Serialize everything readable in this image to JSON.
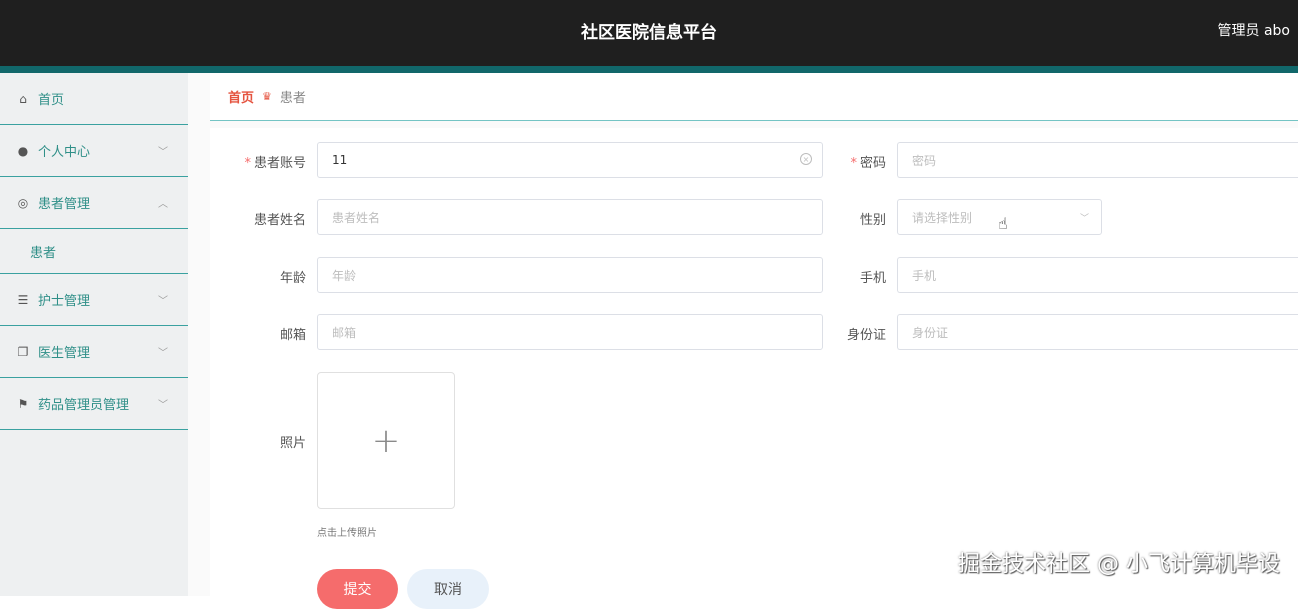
{
  "header": {
    "title": "社区医院信息平台",
    "user": "管理员 abo"
  },
  "sidebar": {
    "items": [
      {
        "label": "首页",
        "icon": "home-icon"
      },
      {
        "label": "个人中心",
        "icon": "user-icon"
      },
      {
        "label": "患者管理",
        "icon": "lifebuoy-icon"
      },
      {
        "label": "护士管理",
        "icon": "list-icon"
      },
      {
        "label": "医生管理",
        "icon": "copy-icon"
      },
      {
        "label": "药品管理员管理",
        "icon": "flag-icon"
      }
    ],
    "submenu": {
      "label": "患者"
    }
  },
  "breadcrumb": {
    "home": "首页",
    "current": "患者"
  },
  "form": {
    "account": {
      "label": "患者账号",
      "value": "11"
    },
    "password": {
      "label": "密码",
      "placeholder": "密码"
    },
    "name": {
      "label": "患者姓名",
      "placeholder": "患者姓名"
    },
    "gender": {
      "label": "性别",
      "placeholder": "请选择性别"
    },
    "age": {
      "label": "年龄",
      "placeholder": "年龄"
    },
    "phone": {
      "label": "手机",
      "placeholder": "手机"
    },
    "email": {
      "label": "邮箱",
      "placeholder": "邮箱"
    },
    "idcard": {
      "label": "身份证",
      "placeholder": "身份证"
    },
    "photo": {
      "label": "照片",
      "hint": "点击上传照片"
    },
    "submit_label": "提交",
    "cancel_label": "取消"
  },
  "watermark": "掘金技术社区 @ 小飞计算机毕设"
}
